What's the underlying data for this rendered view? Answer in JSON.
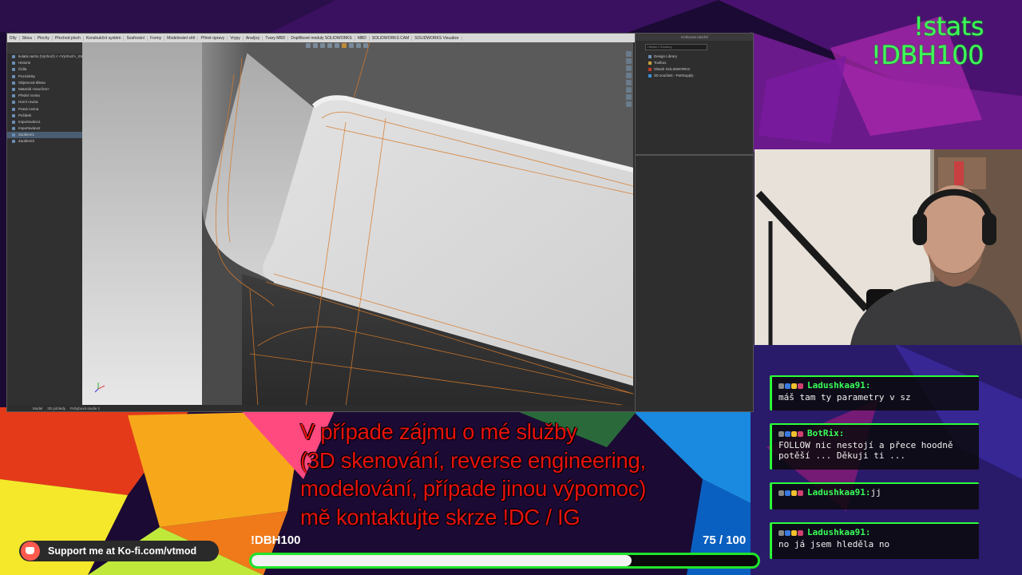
{
  "overlay": {
    "commands": [
      "!stats",
      "!DBH100"
    ]
  },
  "cad": {
    "menu_items": [
      "Díly",
      "Skica",
      "Plochy",
      "Přechod ploch",
      "Konstrukční systém",
      "Svařování",
      "Formy",
      "Modelování sítě",
      "Přímé úpravy",
      "Vrypy",
      "Analýzy",
      "Tvary MBD",
      "Doplňkové moduly SOLIDWORKS",
      "MBD",
      "SOLIDWORKS CAM",
      "SOLIDWORKS Visualize"
    ],
    "tree_items": [
      "kulatá nacho (Výchozí) < <Výchozí>_Stav",
      "Historie",
      "Čidla",
      "Poznámky",
      "Objemová tělesa",
      "Materiál <neurčen>",
      "Přední rovina",
      "Horní rovina",
      "Pravá rovina",
      "Počátek",
      "Importováno1",
      "Importováno2",
      "Zaoblení1",
      "Zaoblení2"
    ],
    "status_tabs": [
      "Model",
      "3D pohledy",
      "Pohybová studie 1"
    ],
    "right_panel_title": "Knihovna návrhů",
    "search_placeholder": "Hledat v Soubory",
    "library_items": [
      {
        "label": "Design Library",
        "color": "#6b8fb5"
      },
      {
        "label": "Toolbox",
        "color": "#c8a23a"
      },
      {
        "label": "Obsah SOLIDWORKS",
        "color": "#c0392b"
      },
      {
        "label": "3D součásti - PartSupply",
        "color": "#3a8fd8"
      }
    ]
  },
  "chat": {
    "messages": [
      {
        "user": "Ladushkaa91:",
        "text": "máš tam ty parametry v sz"
      },
      {
        "user": "BotRix:",
        "text": "FOLLOW nic nestojí a přece hoodně potěší ... Děkuji ti ..."
      },
      {
        "user": "Ladushkaa91:",
        "text": "jj"
      },
      {
        "user": "Ladushkaa91:",
        "text": "no já jsem hleděla no"
      }
    ]
  },
  "subtitle": {
    "lines": [
      "V případe zájmu o mé služby",
      "(3D skenování, reverse engineering,",
      "modelování, případe jinou výpomoc)",
      "mě kontaktujte skrze !DC / IG"
    ]
  },
  "goal": {
    "label": "!DBH100",
    "current": 75,
    "target": 100,
    "count_text": "75  / 100",
    "progress": 0.75
  },
  "kofi": {
    "label": "Support me at Ko-fi.com/vtmod"
  }
}
